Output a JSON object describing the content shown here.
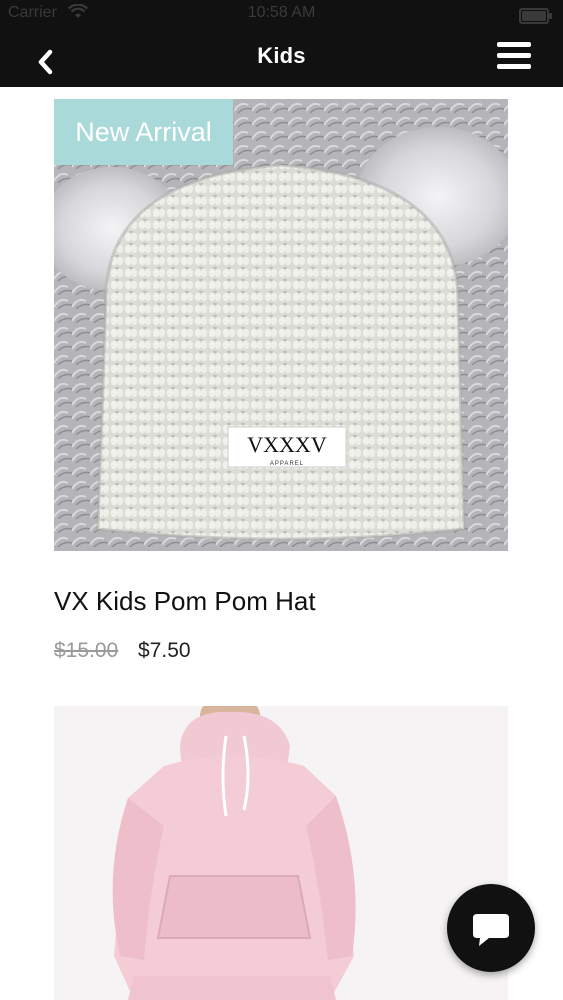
{
  "status_bar": {
    "carrier": "Carrier",
    "time": "10:58 AM"
  },
  "header": {
    "title": "Kids",
    "back_icon": "chevron-left-icon",
    "menu_icon": "hamburger-menu-icon"
  },
  "products": [
    {
      "badge": "New Arrival",
      "name": "VX Kids Pom Pom Hat",
      "price_original": "$15.00",
      "price_sale": "$7.50",
      "label_text": "VXXXV",
      "label_sub": "APPAREL"
    },
    {
      "image": "pink hoodie"
    }
  ],
  "chat_button": {
    "icon": "chat-bubble-icon"
  },
  "colors": {
    "header_bg": "#111111",
    "badge_bg": "#a9dad9"
  }
}
